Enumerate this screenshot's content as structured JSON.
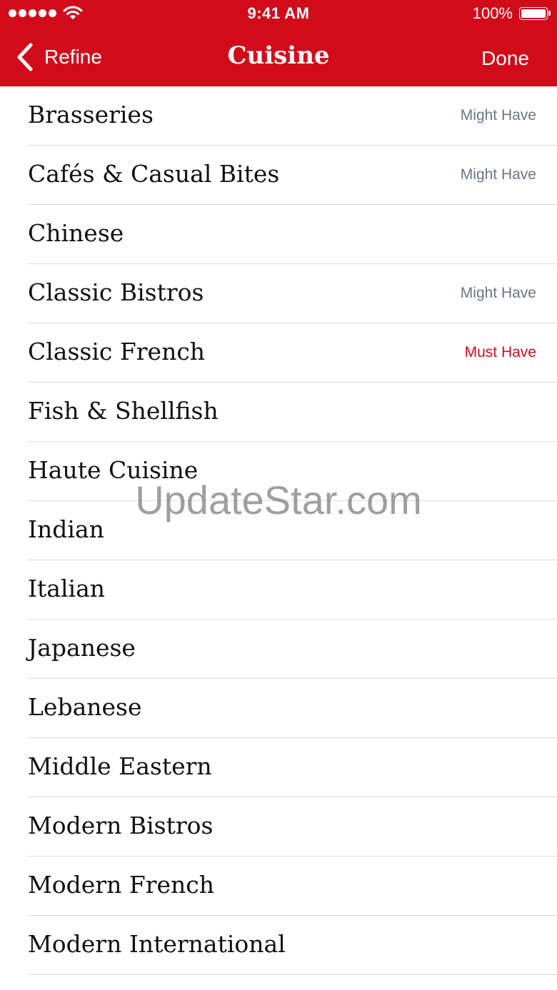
{
  "status_bar": {
    "time": "9:41 AM",
    "battery_percent": "100%",
    "signal_icon": "cellular-signal-icon",
    "wifi_icon": "wifi-icon",
    "battery_icon": "battery-full-icon"
  },
  "nav": {
    "back_label": "Refine",
    "back_icon": "chevron-left-icon",
    "title": "Cuisine",
    "done_label": "Done"
  },
  "colors": {
    "header_bg": "#d20b1b",
    "must_have": "#d20b1b",
    "might_have": "#6b7683",
    "divider": "#dcdcdc"
  },
  "items": [
    {
      "label": "Brasseries",
      "status": "Might Have"
    },
    {
      "label": "Cafés & Casual Bites",
      "status": "Might Have"
    },
    {
      "label": "Chinese",
      "status": ""
    },
    {
      "label": "Classic Bistros",
      "status": "Might Have"
    },
    {
      "label": "Classic French",
      "status": "Must Have"
    },
    {
      "label": "Fish & Shellfish",
      "status": ""
    },
    {
      "label": "Haute Cuisine",
      "status": ""
    },
    {
      "label": "Indian",
      "status": ""
    },
    {
      "label": "Italian",
      "status": ""
    },
    {
      "label": "Japanese",
      "status": ""
    },
    {
      "label": "Lebanese",
      "status": ""
    },
    {
      "label": "Middle Eastern",
      "status": ""
    },
    {
      "label": "Modern Bistros",
      "status": ""
    },
    {
      "label": "Modern French",
      "status": ""
    },
    {
      "label": "Modern International",
      "status": ""
    }
  ],
  "watermark": "UpdateStar.com"
}
